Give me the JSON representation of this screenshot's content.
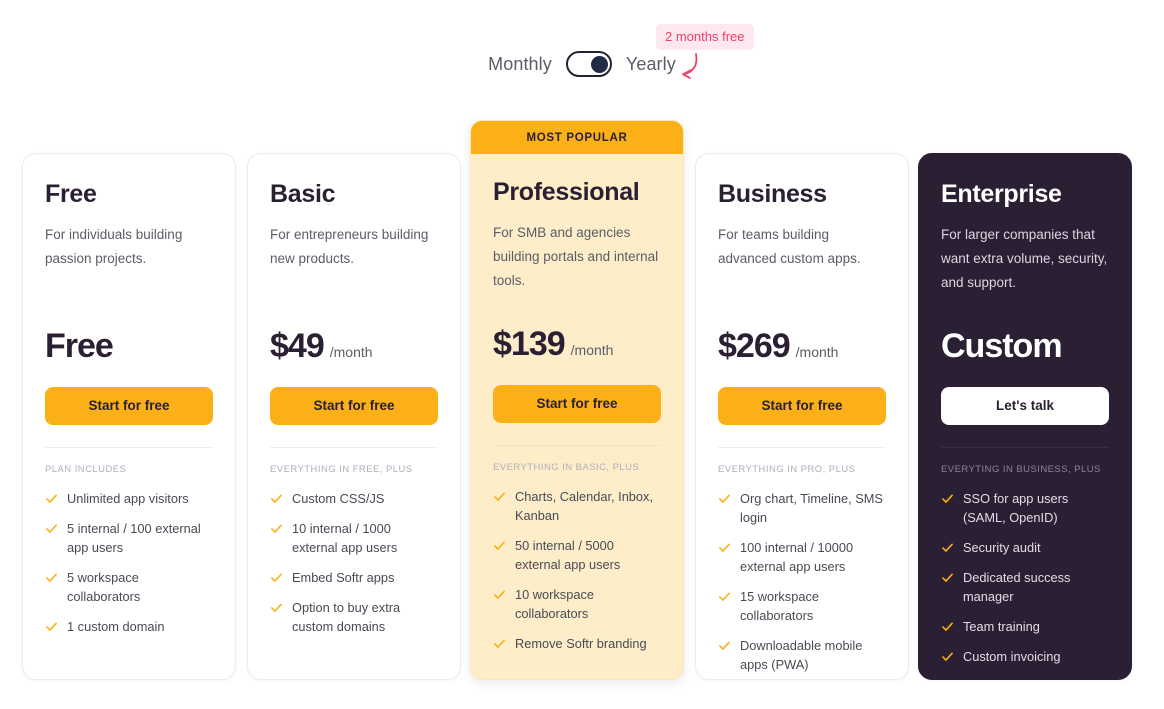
{
  "billing_toggle": {
    "monthly_label": "Monthly",
    "yearly_label": "Yearly",
    "selected": "Yearly",
    "promo_badge": "2 months free",
    "promo_badge_bg": "#fde8ef",
    "promo_badge_color": "#ef4068",
    "knob_color": "#1f2a44",
    "arrow_color": "#ef4068"
  },
  "theme": {
    "accent": "#fbb017",
    "dark_card_bg": "#2b1f33",
    "popular_card_bg": "#fdeec9",
    "check_color": "#fbb017",
    "text_dark": "#2b2033"
  },
  "plans": [
    {
      "id": "free",
      "name": "Free",
      "description": "For individuals building passion projects.",
      "price": "Free",
      "period": "",
      "cta": "Start for free",
      "ribbon": "",
      "features_heading": "PLAN INCLUDES",
      "features": [
        "Unlimited app visitors",
        "5 internal / 100 external app users",
        "5 workspace collaborators",
        "1 custom domain"
      ]
    },
    {
      "id": "basic",
      "name": "Basic",
      "description": "For entrepreneurs building new products.",
      "price": "$49",
      "period": "/month",
      "cta": "Start for free",
      "ribbon": "",
      "features_heading": "EVERYTHING IN FREE, PLUS",
      "features": [
        "Custom CSS/JS",
        "10 internal / 1000 external app users",
        "Embed Softr apps",
        "Option to buy extra custom domains"
      ]
    },
    {
      "id": "professional",
      "name": "Professional",
      "description": "For SMB and agencies building portals and internal tools.",
      "price": "$139",
      "period": "/month",
      "cta": "Start for free",
      "ribbon": "MOST POPULAR",
      "features_heading": "EVERYTHING IN BASIC, PLUS",
      "features": [
        "Charts, Calendar, Inbox, Kanban",
        "50 internal / 5000 external app users",
        "10 workspace collaborators",
        "Remove Softr branding"
      ]
    },
    {
      "id": "business",
      "name": "Business",
      "description": "For teams building advanced custom apps.",
      "price": "$269",
      "period": "/month",
      "cta": "Start for free",
      "ribbon": "",
      "features_heading": "EVERYTHING IN PRO, PLUS",
      "features": [
        "Org chart, Timeline, SMS login",
        "100 internal / 10000 external app users",
        "15 workspace collaborators",
        "Downloadable mobile apps (PWA)"
      ]
    },
    {
      "id": "enterprise",
      "name": "Enterprise",
      "description": "For larger companies that want extra volume, security, and support.",
      "price": "Custom",
      "period": "",
      "cta": "Let's talk",
      "ribbon": "",
      "features_heading": "EVERYTING IN BUSINESS, PLUS",
      "features": [
        "SSO for app users (SAML, OpenID)",
        "Security audit",
        "Dedicated success manager",
        "Team training",
        "Custom invoicing"
      ]
    }
  ]
}
